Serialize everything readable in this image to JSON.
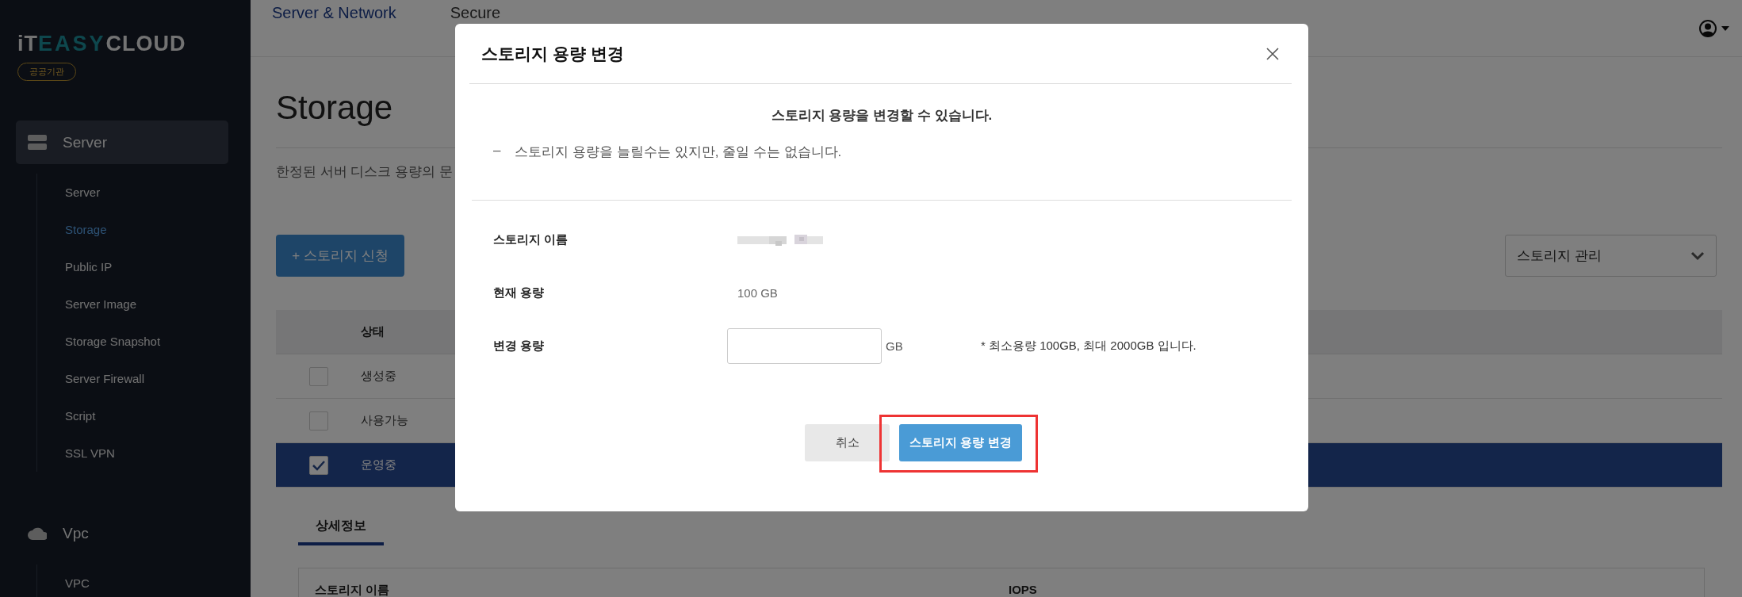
{
  "sidebar": {
    "logo": [
      {
        "text": "iT",
        "kind": "plain"
      },
      {
        "text": "EASY",
        "kind": "accent"
      },
      {
        "text": "CLOUD",
        "kind": "plain"
      }
    ],
    "badge": "공공기관",
    "groups": [
      {
        "label": "Server",
        "selected": true,
        "items": [
          {
            "label": "Server",
            "selected": false
          },
          {
            "label": "Storage",
            "selected": true
          },
          {
            "label": "Public IP",
            "selected": false
          },
          {
            "label": "Server Image",
            "selected": false
          },
          {
            "label": "Storage Snapshot",
            "selected": false
          },
          {
            "label": "Server Firewall",
            "selected": false
          },
          {
            "label": "Script",
            "selected": false
          },
          {
            "label": "SSL VPN",
            "selected": false
          }
        ]
      },
      {
        "label": "Vpc",
        "selected": false,
        "items": [
          {
            "label": "VPC",
            "selected": false
          }
        ]
      }
    ]
  },
  "top_tabs": [
    {
      "label": "Server & Network",
      "selected": true
    },
    {
      "label": "Secure",
      "selected": false
    }
  ],
  "page": {
    "title": "Storage",
    "description": "한정된 서버 디스크 용량의 문",
    "add_button": "+ 스토리지 신청",
    "manage_select": "스토리지 관리"
  },
  "table": {
    "columns": [
      "상태"
    ],
    "rows": [
      {
        "status": "생성중",
        "checked": false,
        "selected": false
      },
      {
        "status": "사용가능",
        "checked": false,
        "selected": false
      },
      {
        "status": "운영중",
        "checked": true,
        "selected": true
      }
    ]
  },
  "detail": {
    "tabs": [
      {
        "label": "상세정보",
        "selected": true
      }
    ],
    "fields": [
      "스토리지 이름",
      "IOPS"
    ]
  },
  "dialog": {
    "title": "스토리지 용량 변경",
    "heading": "스토리지 용량을 변경할 수 있습니다.",
    "notes": [
      {
        "bullet": "–",
        "text": "스토리지 용량을 늘릴수는 있지만, 줄일 수는 없습니다."
      }
    ],
    "fields": [
      {
        "kind": "redacted",
        "label": "스토리지 이름"
      },
      {
        "kind": "text",
        "label": "현재 용량",
        "value": "100 GB"
      },
      {
        "kind": "input",
        "label": "변경 용량",
        "unit": "GB",
        "hint": "* 최소용량 100GB, 최대 2000GB 입니다."
      }
    ],
    "buttons": [
      {
        "label": "취소",
        "kind": "secondary",
        "highlighted": false
      },
      {
        "label": "스토리지 용량 변경",
        "kind": "primary",
        "highlighted": true
      }
    ]
  }
}
